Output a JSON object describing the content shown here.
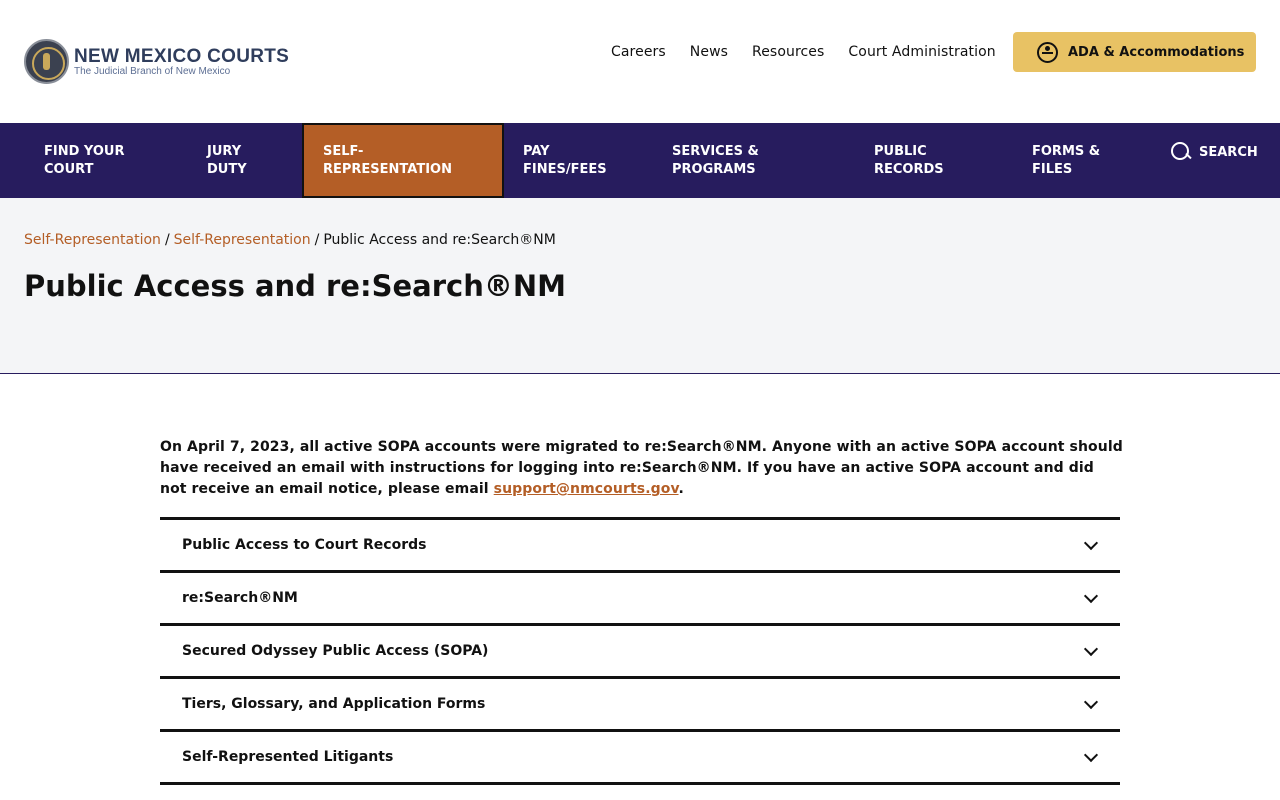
{
  "header": {
    "logo_title": "NEW MEXICO COURTS",
    "logo_subtitle": "The Judicial Branch of New Mexico",
    "utility_links": [
      "Careers",
      "News",
      "Resources",
      "Court Administration"
    ],
    "ada_button": "ADA & Accommodations"
  },
  "nav": {
    "items": [
      "FIND YOUR\nCOURT",
      "JURY\nDUTY",
      "SELF-\nREPRESENTATION",
      "PAY\nFINES/FEES",
      "SERVICES &\nPROGRAMS",
      "PUBLIC\nRECORDS",
      "FORMS &\nFILES"
    ],
    "search_label": "SEARCH",
    "active_index": 2
  },
  "breadcrumb": {
    "items": [
      "Self-Representation",
      "Self-Representation"
    ],
    "current": "Public Access and re:Search®NM",
    "separator": "/"
  },
  "page_title": "Public Access and re:Search®NM",
  "notice": {
    "text_before": "On April 7, 2023, all active SOPA accounts were migrated to re:Search®NM. Anyone with an active SOPA account should have received an email with instructions for logging into re:Search®NM. If you have an active SOPA account and did not receive an email notice, please email ",
    "email": "support@nmcourts.gov",
    "text_after": "."
  },
  "accordion": [
    "Public Access to Court Records",
    "re:Search®NM",
    "Secured Odyssey Public Access (SOPA)",
    "Tiers, Glossary, and Application Forms",
    "Self-Represented Litigants"
  ],
  "colors": {
    "nav_bg": "#271c5e",
    "active_nav": "#b45e26",
    "ada_button": "#e8c264",
    "link": "#b45e26"
  }
}
